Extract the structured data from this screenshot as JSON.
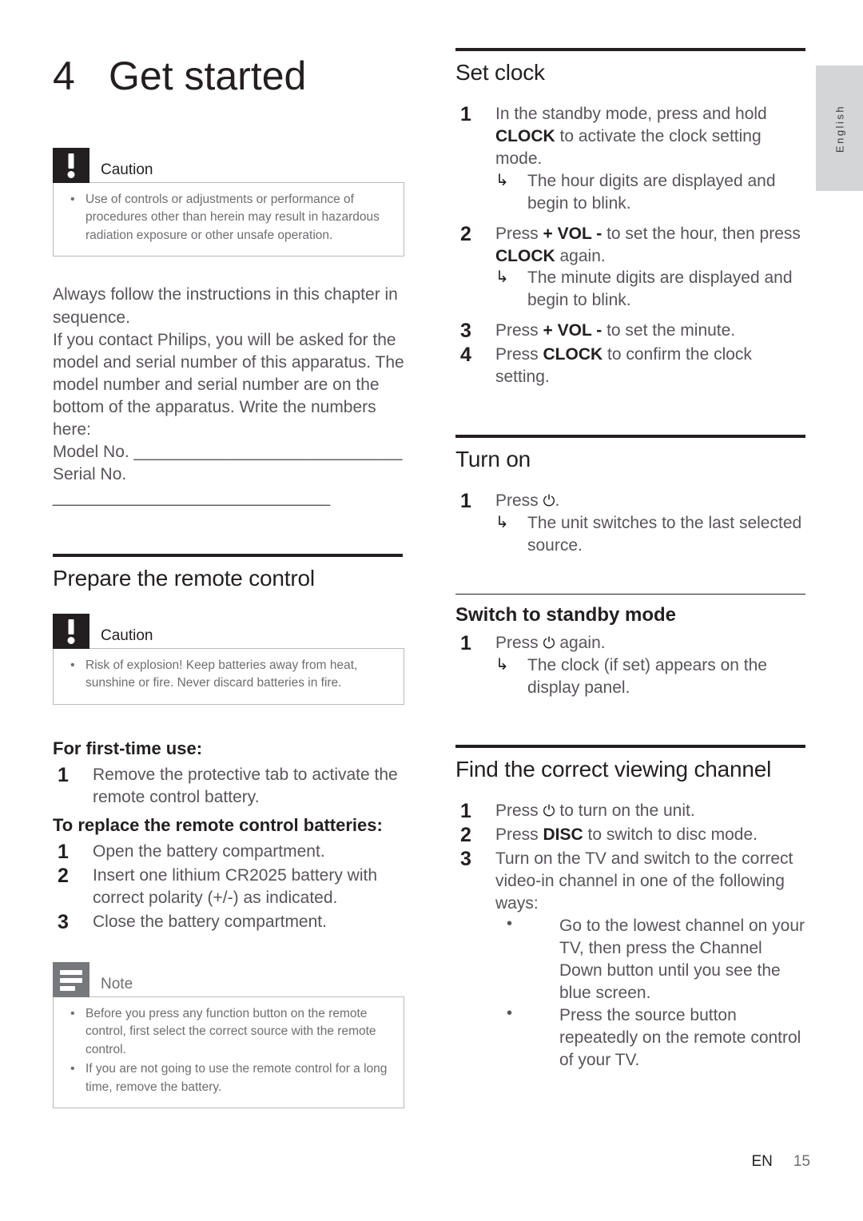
{
  "language_tab": {
    "label": "English"
  },
  "chapter": {
    "number": "4",
    "title": "Get started"
  },
  "left_column": {
    "caution_1": {
      "icon": "caution-exclamation-icon",
      "label": "Caution",
      "items": [
        "Use of controls or adjustments or performance of procedures other than herein may result in hazardous radiation exposure or other unsafe operation."
      ]
    },
    "intro_paragraph_1": "Always follow the instructions in this chapter in sequence.",
    "intro_paragraph_2": "If you contact Philips, you will be asked for the model and serial number of this apparatus. The model number and serial number are on the bottom of the apparatus. Write the numbers here:",
    "model_no_label": "Model No. ",
    "model_no_fill": "______________________________",
    "serial_no_label": "Serial No. ",
    "serial_no_fill": "_______________________________",
    "section_prepare": {
      "heading": "Prepare the remote control",
      "caution": {
        "icon": "caution-exclamation-icon",
        "label": "Caution",
        "items": [
          "Risk of explosion! Keep batteries away from heat, sunshine or fire. Never discard batteries in fire."
        ]
      },
      "first_time_heading": "For first-time use:",
      "first_time_steps": [
        {
          "num": "1",
          "text": "Remove the protective tab to activate the remote control battery."
        }
      ],
      "replace_heading": "To replace the remote control batteries:",
      "replace_steps": [
        {
          "num": "1",
          "text": "Open the battery compartment."
        },
        {
          "num": "2",
          "text": "Insert one lithium CR2025 battery with correct polarity (+/-) as indicated."
        },
        {
          "num": "3",
          "text": "Close the battery compartment."
        }
      ],
      "note": {
        "icon": "note-lines-icon",
        "label": "Note",
        "items": [
          "Before you press any function button on the remote control, first select the correct source with the remote control.",
          "If you are not going to use the remote control for a long time, remove the battery."
        ]
      }
    }
  },
  "right_column": {
    "section_set_clock": {
      "heading": "Set clock",
      "steps": [
        {
          "num": "1",
          "parts": [
            {
              "t": "In the standby mode, press and hold ",
              "b": false
            },
            {
              "t": "CLOCK",
              "b": true
            },
            {
              "t": " to activate the clock setting mode.",
              "b": false
            }
          ],
          "results": [
            "The hour digits are displayed and begin to blink."
          ]
        },
        {
          "num": "2",
          "parts": [
            {
              "t": "Press ",
              "b": false
            },
            {
              "t": "+ VOL -",
              "b": true
            },
            {
              "t": " to set the hour, then press ",
              "b": false
            },
            {
              "t": "CLOCK",
              "b": true
            },
            {
              "t": " again.",
              "b": false
            }
          ],
          "results": [
            "The minute digits are displayed and begin to blink."
          ]
        },
        {
          "num": "3",
          "parts": [
            {
              "t": "Press ",
              "b": false
            },
            {
              "t": "+ VOL -",
              "b": true
            },
            {
              "t": " to set the minute.",
              "b": false
            }
          ],
          "results": []
        },
        {
          "num": "4",
          "parts": [
            {
              "t": "Press ",
              "b": false
            },
            {
              "t": "CLOCK",
              "b": true
            },
            {
              "t": " to confirm the clock setting.",
              "b": false
            }
          ],
          "results": []
        }
      ]
    },
    "section_turn_on": {
      "heading": "Turn on",
      "step_num": "1",
      "step_text_before": "Press ",
      "step_power_icon": "power-standby-icon",
      "step_power_glyph": "⏻",
      "step_text_after": ".",
      "results": [
        "The unit switches to the last selected source."
      ],
      "subsection": {
        "heading": "Switch to standby mode",
        "step_num": "1",
        "step_text_before": "Press ",
        "step_power_glyph": "⏻",
        "step_text_after": " again.",
        "results": [
          "The clock (if set) appears on the display panel."
        ]
      }
    },
    "section_find_channel": {
      "heading": "Find the correct viewing channel",
      "steps": [
        {
          "num": "1",
          "before": "Press ",
          "glyph": "⏻",
          "after": " to turn on the unit.",
          "bold": ""
        },
        {
          "num": "2",
          "before": "Press ",
          "bold": "DISC",
          "after": " to switch to disc mode.",
          "glyph": ""
        },
        {
          "num": "3",
          "before": "Turn on the TV and switch to the correct video-in channel in one of the following ways:",
          "bold": "",
          "after": "",
          "glyph": ""
        }
      ],
      "sub_bullets": [
        "Go to the lowest channel on your TV, then press the Channel Down button until you see the blue screen.",
        "Press the source button repeatedly on the remote control of your TV."
      ]
    }
  },
  "footer": {
    "lang_code": "EN",
    "page_number": "15"
  }
}
